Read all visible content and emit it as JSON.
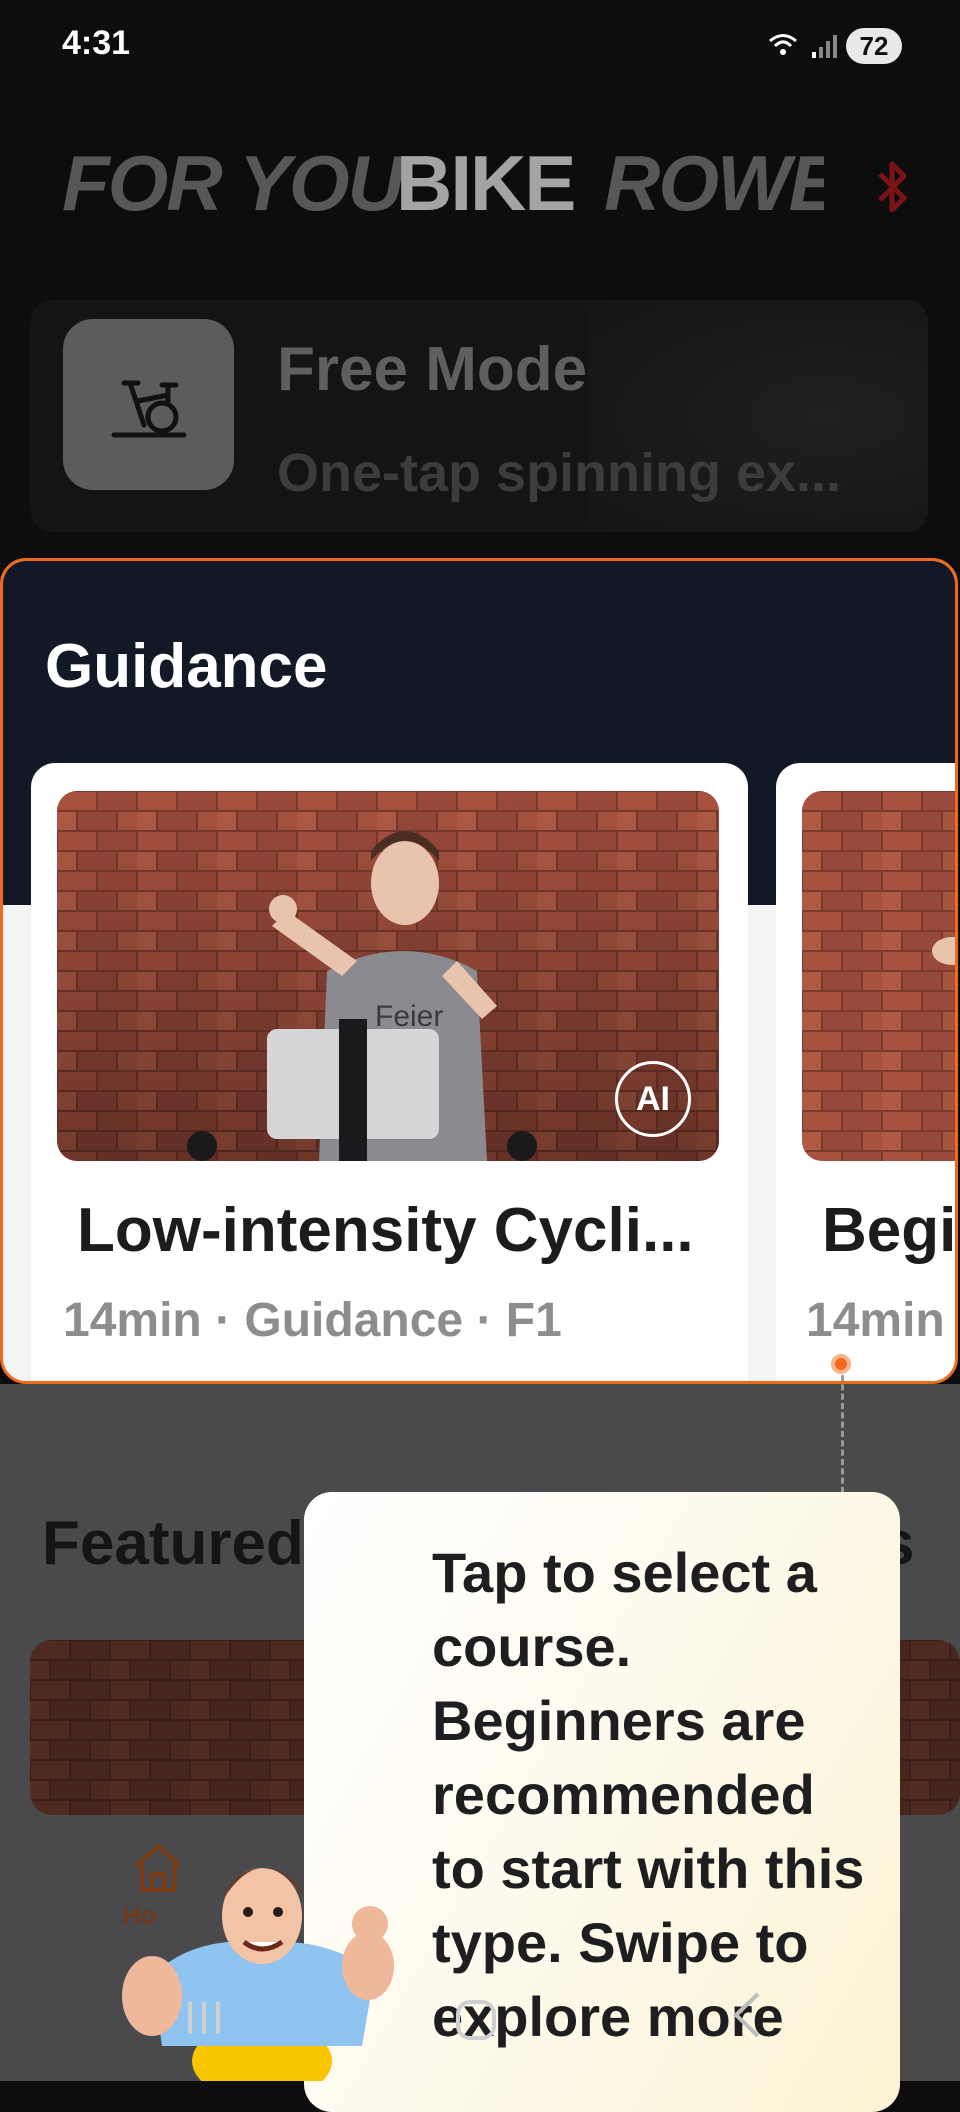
{
  "status_bar": {
    "time": "4:31",
    "battery": "72"
  },
  "tabs": [
    {
      "label": "FOR YOU",
      "active": false
    },
    {
      "label": "BIKE",
      "active": true
    },
    {
      "label": "ROWER",
      "active": false
    }
  ],
  "free_mode": {
    "title": "Free Mode",
    "subtitle": "One-tap spinning ex..."
  },
  "guidance": {
    "title": "Guidance",
    "courses": [
      {
        "title": "Low-intensity Cycli...",
        "meta": "14min · Guidance · F1",
        "badge": "AI",
        "shirt_text": "Feier"
      },
      {
        "title": "Begi",
        "meta": "14min"
      }
    ]
  },
  "featured": {
    "title_left": "Featured",
    "title_right": "s"
  },
  "bottom_nav": {
    "home_label": "Ho"
  },
  "tooltip": {
    "text": "Tap to select a course. Beginners are recommended to start with this type. Swipe to explore more"
  },
  "colors": {
    "accent": "#f06a1d",
    "guidance_bg": "#121826",
    "tooltip_bg": "#fdf9ea"
  }
}
